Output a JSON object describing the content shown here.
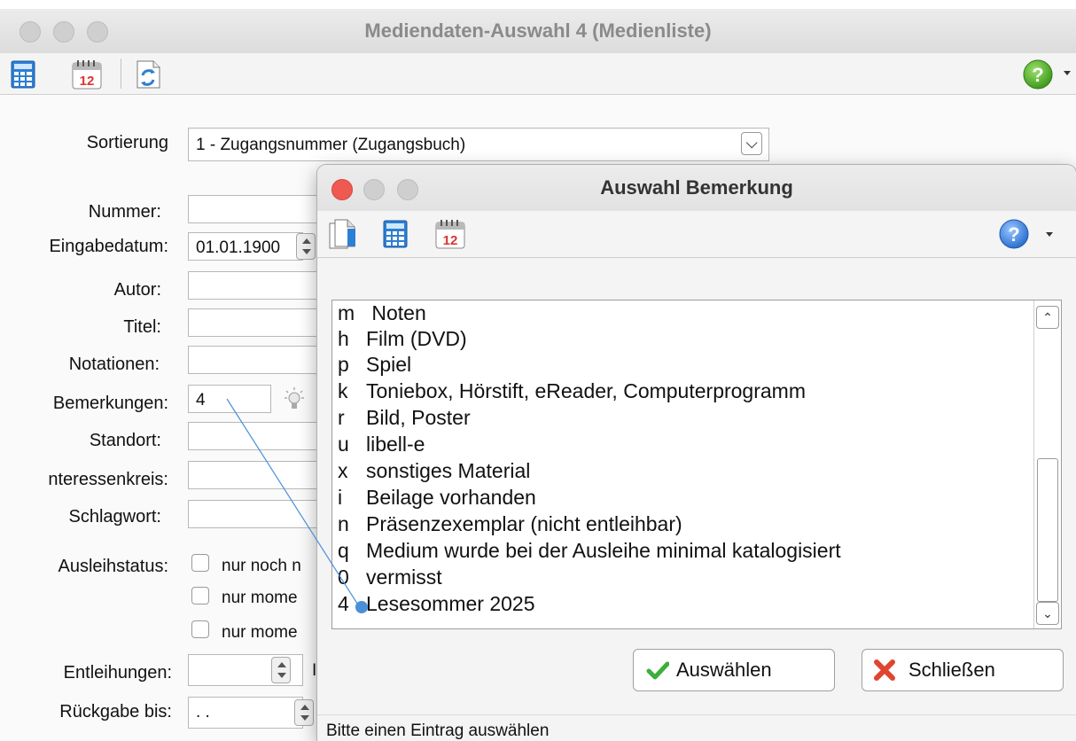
{
  "main_window": {
    "title": "Mediendaten-Auswahl 4 (Medienliste)",
    "toolbar": {
      "icons": [
        "calculator-icon",
        "calendar-icon",
        "refresh-icon",
        "help-icon"
      ],
      "calendar_day": "12",
      "help_glyph": "?"
    },
    "form": {
      "sort_label": "Sortierung",
      "sort_value": "1 - Zugangsnummer (Zugangsbuch)",
      "number_label": "Nummer:",
      "date_label": "Eingabedatum:",
      "date_value": "01.01.1900",
      "author_label": "Autor:",
      "title_label": "Titel:",
      "notations_label": "Notationen:",
      "remarks_label": "Bemerkungen:",
      "remarks_value": "4",
      "location_label": "Standort:",
      "interest_label": "nteressenkreis:",
      "keyword_label": "Schlagwort:",
      "loan_status_label": "Ausleihstatus:",
      "loan_options": [
        "nur noch n",
        "nur mome",
        "nur mome"
      ],
      "loans_label": "Entleihungen:",
      "loans_trailing": "I",
      "return_label": "Rückgabe bis:",
      "return_value": ". ."
    }
  },
  "dialog": {
    "title": "Auswahl Bemerkung",
    "toolbar_icons": [
      "new-document-icon",
      "calculator-icon",
      "calendar-icon",
      "help-icon"
    ],
    "calendar_day": "12",
    "help_glyph": "?",
    "items": [
      {
        "code": "m",
        "label": " Noten"
      },
      {
        "code": "h",
        "label": "Film (DVD)"
      },
      {
        "code": "p",
        "label": "Spiel"
      },
      {
        "code": "k",
        "label": "Toniebox, Hörstift, eReader, Computerprogramm"
      },
      {
        "code": "r",
        "label": "Bild, Poster"
      },
      {
        "code": "u",
        "label": "libell-e"
      },
      {
        "code": "x",
        "label": "sonstiges Material"
      },
      {
        "code": "i",
        "label": "Beilage vorhanden"
      },
      {
        "code": "n",
        "label": "Präsenzexemplar (nicht entleihbar)"
      },
      {
        "code": "q",
        "label": "Medium wurde bei der Ausleihe minimal katalogisiert"
      },
      {
        "code": "0",
        "label": "vermisst"
      },
      {
        "code": "4",
        "label": "Lesesommer 2025"
      }
    ],
    "select_button": "Auswählen",
    "close_button": "Schließen",
    "status": "Bitte einen Eintrag auswählen"
  },
  "colors": {
    "accent_line": "#4a90d9",
    "select_check": "#3cae3c",
    "close_x": "#e0452f",
    "traffic_red": "#ee5a52"
  }
}
